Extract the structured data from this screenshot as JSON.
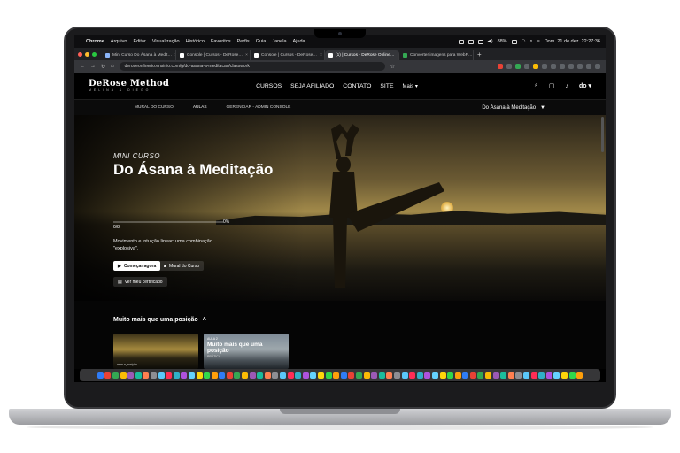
{
  "menubar": {
    "items": [
      "Chrome",
      "Arquivo",
      "Editar",
      "Visualização",
      "Histórico",
      "Favoritos",
      "Perfis",
      "Guia",
      "Janela",
      "Ajuda"
    ],
    "battery": "88%",
    "clock": "Dom. 21 de dez. 22:27:36"
  },
  "tabs": [
    {
      "label": "Mini Curso Do Ásana à Medit…",
      "active": false
    },
    {
      "label": "Console | Cursos - DeRose…",
      "active": false
    },
    {
      "label": "Console | Cursos - DeRose…",
      "active": false
    },
    {
      "label": "(1) | Cursos - DeRose Online…",
      "active": true
    },
    {
      "label": "Converter imagens para WebP…",
      "active": false
    }
  ],
  "address": {
    "url": "deroseonlinerio.ensinio.com/g/do-asana-a-meditacao/classwork"
  },
  "site": {
    "logo_main": "DeRose Method",
    "logo_sub": "MELINA & DIEGO",
    "nav": [
      "CURSOS",
      "SEJA AFILIADO",
      "CONTATO",
      "SITE"
    ],
    "more": "Mais",
    "user_badge": "do"
  },
  "subnav": {
    "items": [
      "MURAL DO CURSO",
      "AULAS",
      "GERENCIAR - ADMIN CONSOLE"
    ],
    "active": "AULAS",
    "course_select": "Do Ásana à Meditação"
  },
  "hero": {
    "kicker": "MINI CURSO",
    "title": "Do Ásana à Meditação",
    "progress_count": "0/8",
    "progress_percent": "0%",
    "progress_value": 0,
    "description": "Movimento e intuição linear: uma combinação \"explosiva\".",
    "buttons": {
      "start": "Começar agora",
      "mural": "Mural do Curso",
      "certificate": "Ver meu certificado"
    }
  },
  "section": {
    "title": "Muito mais que uma posição",
    "cards": [
      {
        "tag": "",
        "title": "",
        "sub": "",
        "caption": "nem a posição"
      },
      {
        "tag": "AULA 2",
        "title": "Muito mais que uma posição",
        "sub": "PRÁTICA",
        "caption": ""
      }
    ]
  },
  "colors": {
    "background": "#000000",
    "accent": "#ffffff",
    "sunset": "#d9a646"
  }
}
